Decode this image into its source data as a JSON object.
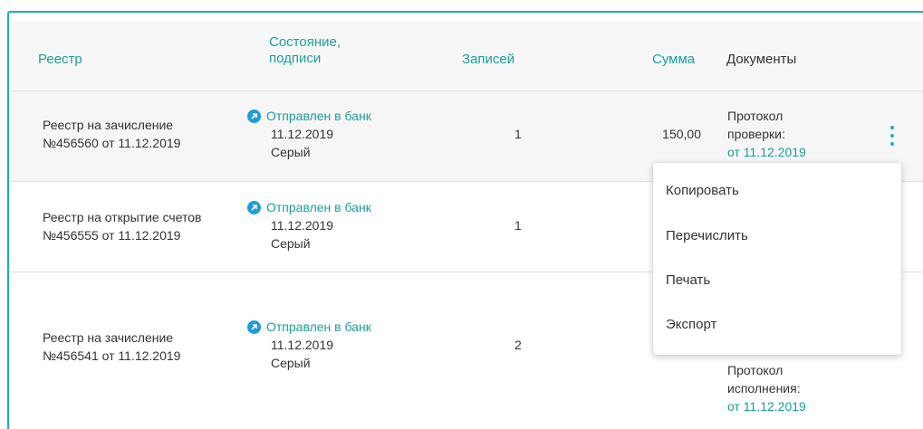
{
  "header": {
    "col_registry": "Реестр",
    "col_status_line1": "Состояние,",
    "col_status_line2": "подписи",
    "col_records": "Записей",
    "col_amount": "Сумма",
    "col_documents": "Документы"
  },
  "rows": [
    {
      "name_line1": "Реестр на зачисление",
      "name_line2": "№456560 от 11.12.2019",
      "status": "Отправлен в банк",
      "status_date": "11.12.2019",
      "signer": "Серый",
      "records": "1",
      "amount": "150,00",
      "doc_line1": "Протокол",
      "doc_line2": "проверки:",
      "doc_link": "от 11.12.2019"
    },
    {
      "name_line1": "Реестр на открытие счетов",
      "name_line2": "№456555 от 11.12.2019",
      "status": "Отправлен в банк",
      "status_date": "11.12.2019",
      "signer": "Серый",
      "records": "1"
    },
    {
      "name_line1": "Реестр на зачисление",
      "name_line2": "№456541 от 11.12.2019",
      "status": "Отправлен в банк",
      "status_date": "11.12.2019",
      "signer": "Серый",
      "records": "2",
      "doc_line1": "Протокол",
      "doc_line2": "исполнения:",
      "doc_link": "от 11.12.2019"
    }
  ],
  "menu": {
    "items": [
      "Копировать",
      "Перечислить",
      "Печать",
      "Экспорт"
    ]
  },
  "icons": {
    "status": "arrow-up-right-circle-icon",
    "row_menu": "more-vertical-icon"
  },
  "colors": {
    "accent_teal": "#199e9e",
    "status_blue": "#1e9be0",
    "frame_teal": "#1fb0b0"
  }
}
